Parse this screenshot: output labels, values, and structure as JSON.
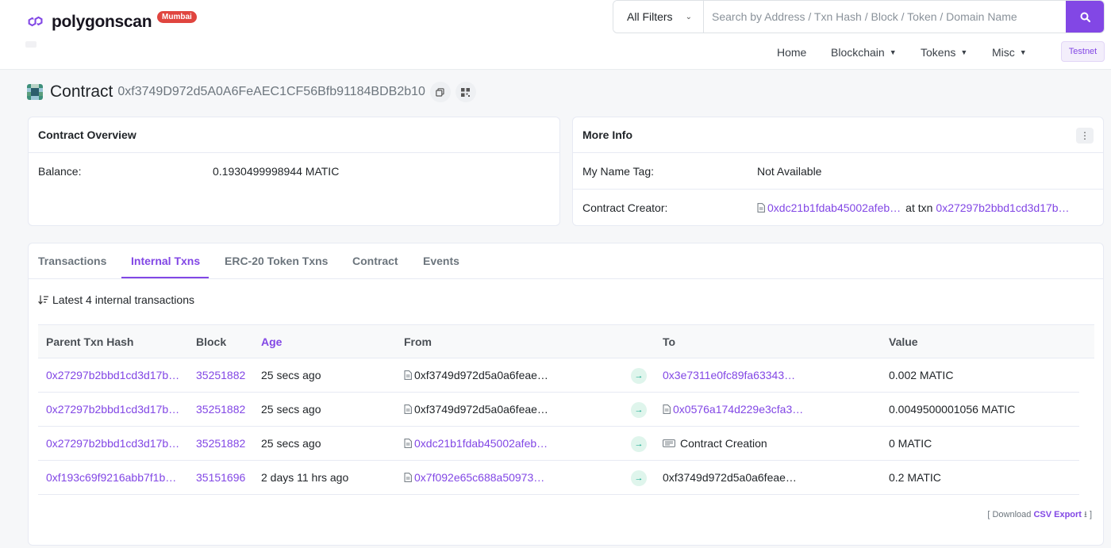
{
  "header": {
    "brand": "polygonscan",
    "network_badge": "Mumbai",
    "filter_label": "All Filters",
    "search_placeholder": "Search by Address / Txn Hash / Block / Token / Domain Name",
    "nav": [
      "Home",
      "Blockchain",
      "Tokens",
      "Misc"
    ],
    "testnet_label": "Testnet"
  },
  "title": {
    "label": "Contract",
    "address": "0xf3749D972d5A0A6FeAEC1CF56Bfb91184BDB2b10"
  },
  "overview": {
    "heading": "Contract Overview",
    "balance_label": "Balance:",
    "balance_value": "0.1930499998944 MATIC"
  },
  "more_info": {
    "heading": "More Info",
    "name_tag_label": "My Name Tag:",
    "name_tag_value": "Not Available",
    "creator_label": "Contract Creator:",
    "creator_address": "0xdc21b1fdab45002afeb…",
    "at_txn_label": "at txn",
    "creator_txn": "0x27297b2bbd1cd3d17b…"
  },
  "tabs": [
    "Transactions",
    "Internal Txns",
    "ERC-20 Token Txns",
    "Contract",
    "Events"
  ],
  "active_tab": "Internal Txns",
  "summary": "Latest 4 internal transactions",
  "table": {
    "columns": [
      "Parent Txn Hash",
      "Block",
      "Age",
      "From",
      "To",
      "Value"
    ],
    "rows": [
      {
        "hash": "0x27297b2bbd1cd3d17b…",
        "block": "35251882",
        "age": "25 secs ago",
        "from": "0xf3749d972d5a0a6feae…",
        "to": "0x3e7311e0fc89fa63343…",
        "value": "0.002 MATIC"
      },
      {
        "hash": "0x27297b2bbd1cd3d17b…",
        "block": "35251882",
        "age": "25 secs ago",
        "from": "0xf3749d972d5a0a6feae…",
        "to": "0x0576a174d229e3cfa3…",
        "value": "0.0049500001056 MATIC"
      },
      {
        "hash": "0x27297b2bbd1cd3d17b…",
        "block": "35251882",
        "age": "25 secs ago",
        "from": "0xdc21b1fdab45002afeb…",
        "to": "Contract Creation",
        "value": "0 MATIC"
      },
      {
        "hash": "0xf193c69f9216abb7f1b…",
        "block": "35151696",
        "age": "2 days 11 hrs ago",
        "from": "0x7f092e65c688a50973…",
        "to": "0xf3749d972d5a0a6feae…",
        "value": "0.2 MATIC"
      }
    ]
  },
  "export": {
    "prefix": "[ Download",
    "link": "CSV Export",
    "suffix": "]"
  },
  "colors": {
    "accent": "#8247e5",
    "badge": "#e0453f",
    "in_badge_bg": "#dff5ec",
    "in_badge_fg": "#00a186"
  },
  "icons": [
    "search-icon",
    "chevron-down-icon",
    "copy-icon",
    "qr-code-icon",
    "kebab-icon",
    "sort-icon",
    "contract-doc-icon",
    "arrow-right-icon",
    "contract-creation-icon",
    "download-icon"
  ]
}
